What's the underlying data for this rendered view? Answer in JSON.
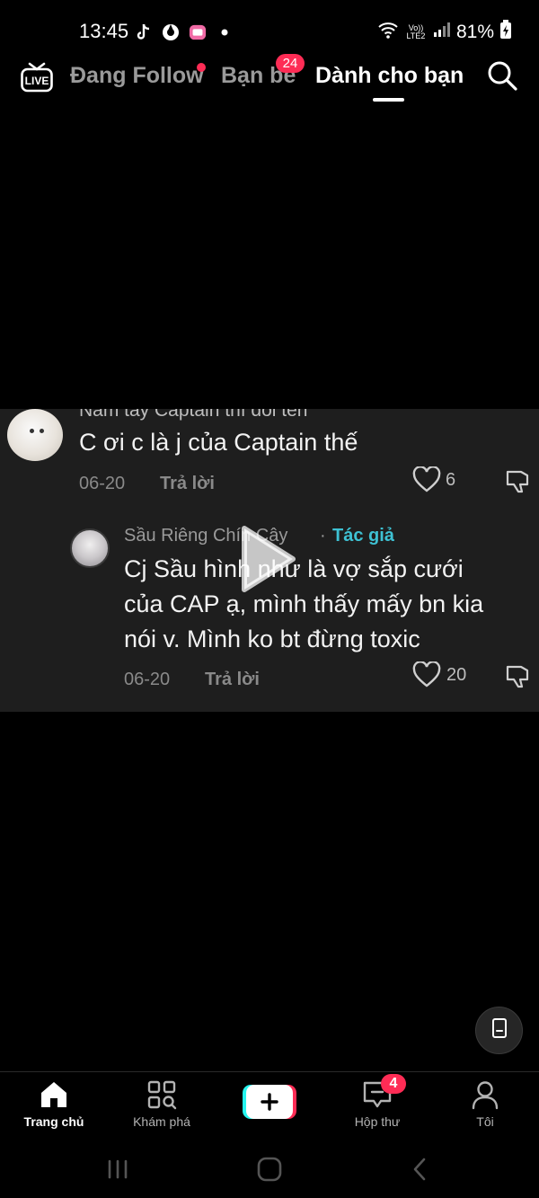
{
  "status_bar": {
    "time": "13:45",
    "network_label": "Vo)) LTE2",
    "battery": "81%"
  },
  "top_nav": {
    "live_label": "LIVE",
    "tabs": [
      {
        "label": "Đang Follow",
        "active": false
      },
      {
        "label": "Bạn bè",
        "active": false,
        "badge": "24"
      },
      {
        "label": "Dành cho bạn",
        "active": true
      }
    ]
  },
  "comments": {
    "cut_line": "Nắm tay Captain thì đổi tên",
    "first": {
      "text": "C ơi c là j của Captain thế",
      "date": "06-20",
      "reply_label": "Trả lời",
      "likes": "6"
    },
    "reply": {
      "author": "Sầu Riêng Chín Cây",
      "separator": "·",
      "author_tag": "Tác giả",
      "lines": [
        "Cj Sầu hình như là vợ sắp cưới",
        "của CAP ạ, mình thấy mấy bn kia",
        "nói v. Mình ko bt đừng toxic"
      ],
      "date": "06-20",
      "reply_label": "Trả lời",
      "likes": "20"
    }
  },
  "bottom_nav": {
    "items": [
      {
        "label": "Trang chủ",
        "icon": "home-icon",
        "active": true
      },
      {
        "label": "Khám phá",
        "icon": "discover-icon",
        "active": false
      },
      {
        "label": "",
        "icon": "create-plus-icon",
        "active": false
      },
      {
        "label": "Hộp thư",
        "icon": "inbox-icon",
        "active": false,
        "badge": "4"
      },
      {
        "label": "Tôi",
        "icon": "profile-icon",
        "active": false
      }
    ]
  },
  "colors": {
    "accent_red": "#fe2c55",
    "author_tag": "#3ec1d3",
    "comment_bg": "#1e1e1e"
  }
}
